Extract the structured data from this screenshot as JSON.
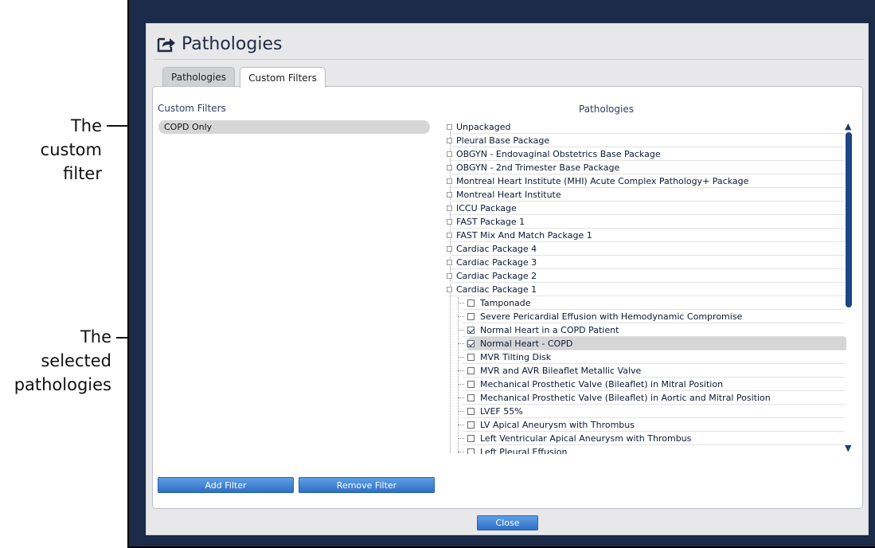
{
  "callouts": {
    "custom_filter": [
      "The",
      "custom",
      "filter"
    ],
    "selected_pathologies": [
      "The",
      "selected",
      "pathologies"
    ]
  },
  "dialog": {
    "title": "Pathologies",
    "title_icon": "export-arrow-icon"
  },
  "tabs": [
    {
      "label": "Pathologies",
      "active": false
    },
    {
      "label": "Custom Filters",
      "active": true
    }
  ],
  "custom_filters": {
    "heading": "Custom Filters",
    "items": [
      "COPD Only"
    ]
  },
  "pathologies": {
    "heading": "Pathologies",
    "packages": [
      "Unpackaged",
      "Pleural Base Package",
      "OBGYN - Endovaginal Obstetrics Base Package",
      "OBGYN - 2nd Trimester Base Package",
      "Montreal Heart Institute (MHI) Acute Complex Pathology+ Package",
      "Montreal Heart Institute",
      "ICCU Package",
      "FAST Package 1",
      "FAST Mix And Match Package 1",
      "Cardiac Package 4",
      "Cardiac Package 3",
      "Cardiac Package 2",
      "Cardiac Package 1"
    ],
    "children": [
      {
        "label": "Tamponade",
        "checked": false
      },
      {
        "label": "Severe Pericardial Effusion with Hemodynamic Compromise",
        "checked": false
      },
      {
        "label": "Normal Heart in a COPD Patient",
        "checked": true
      },
      {
        "label": "Normal Heart - COPD",
        "checked": true,
        "selected": true
      },
      {
        "label": "MVR Tilting Disk",
        "checked": false
      },
      {
        "label": "MVR and AVR Bileaflet Metallic Valve",
        "checked": false
      },
      {
        "label": "Mechanical Prosthetic Valve (Bileaflet) in Mitral Position",
        "checked": false
      },
      {
        "label": "Mechanical Prosthetic Valve (Bileaflet) in Aortic and Mitral Position",
        "checked": false
      },
      {
        "label": "LVEF 55%",
        "checked": false
      },
      {
        "label": "LV Apical Aneurysm with Thrombus",
        "checked": false
      },
      {
        "label": "Left Ventricular Apical Aneurysm with Thrombus",
        "checked": false
      },
      {
        "label": "Left Pleural Effusion",
        "checked": false
      }
    ]
  },
  "buttons": {
    "add_filter": "Add Filter",
    "remove_filter": "Remove Filter",
    "close": "Close"
  },
  "colors": {
    "frame": "#1b2b49",
    "button": "#3a7fd5",
    "scrollbar": "#1f4585"
  }
}
